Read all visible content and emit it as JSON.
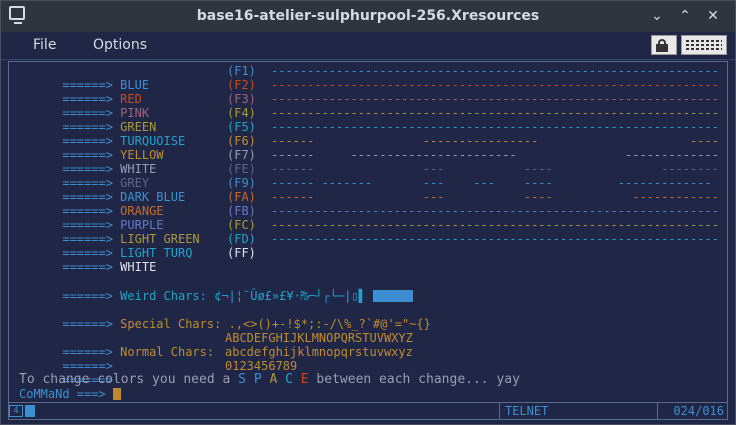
{
  "window": {
    "title": "base16-atelier-sulphurpool-256.Xresources"
  },
  "icons": {
    "app": "terminal-icon",
    "minimize": "minimize-icon",
    "maximize": "maximize-icon",
    "close": "close-icon",
    "lock": "lock-icon",
    "keyboard": "keyboard-icon"
  },
  "window_buttons": {
    "minimize": "⌄",
    "maximize": "⌃",
    "close": "✕"
  },
  "menu": {
    "file": "File",
    "options": "Options"
  },
  "colors": {
    "background": "#202746",
    "arrow": "#3d8fd1",
    "blue": "#3d8fd1",
    "red": "#c94922",
    "pink": "#9c637a",
    "green": "#ac9739",
    "turquoise": "#22a2c9",
    "yellow": "#c08b30",
    "white": "#979db4",
    "grey": "#5e6687",
    "dark_blue": "#3d8fd1",
    "orange": "#c76b29",
    "purple": "#6679cc",
    "light_green": "#ac9739",
    "light_turq": "#22a2c9",
    "bright_white": "#dfe2f1"
  },
  "color_rows": [
    {
      "arrow": "======>",
      "name": "BLUE",
      "key": "(F1)",
      "pattern": "--------------------------------------------------------------"
    },
    {
      "arrow": "======>",
      "name": "RED",
      "key": "(F2)",
      "pattern": "--------------------------------------------------------------"
    },
    {
      "arrow": "======>",
      "name": "PINK",
      "key": "(F3)",
      "pattern": "--------------------------------------------------------------"
    },
    {
      "arrow": "======>",
      "name": "GREEN",
      "key": "(F4)",
      "pattern": "--------------------------------------------------------------"
    },
    {
      "arrow": "======>",
      "name": "TURQUOISE",
      "key": "(F5)",
      "pattern": "--------------------------------------------------------------"
    },
    {
      "arrow": "======>",
      "name": "YELLOW",
      "key": "(F6)",
      "pattern": "------               ----------------                     ----"
    },
    {
      "arrow": "======>",
      "name": "WHITE",
      "key": "(F7)",
      "pattern": "------     -----------------------               -------------"
    },
    {
      "arrow": "======>",
      "name": "GREY",
      "key": "(FE)",
      "pattern": "------               ---           ----               --------"
    },
    {
      "arrow": "======>",
      "name": "DARK BLUE",
      "key": "(F9)",
      "pattern": "------ -------       ---    ---    ----         -------------"
    },
    {
      "arrow": "======>",
      "name": "ORANGE",
      "key": "(FA)",
      "pattern": "------               ---           ----           ------------"
    },
    {
      "arrow": "======>",
      "name": "PURPLE",
      "key": "(FB)",
      "pattern": "--------------------------------------------------------------"
    },
    {
      "arrow": "======>",
      "name": "LIGHT GREEN",
      "key": "(FC)",
      "pattern": "--------------------------------------------------------------"
    },
    {
      "arrow": "======>",
      "name": "LIGHT TURQ",
      "key": "(FD)",
      "pattern": "--------------------------------------------------------------"
    },
    {
      "arrow": "======>",
      "name": "WHITE",
      "key": "(FF)",
      "pattern": ""
    }
  ],
  "weird": {
    "arrow": "======>",
    "label": "Weird Chars:",
    "chars": "¢¬|¦¨Ûø£»£¥·₧⌐┘┌└─|▯▌"
  },
  "special": {
    "arrow": "======>",
    "label": "Special Chars:",
    "chars": ".,<>()+-!$*;:-/\\%_?`#@'=\"~{}"
  },
  "normal": {
    "arrow": "======>",
    "label": "Normal Chars:",
    "upper": "ABCDEFGHIJKLMNOPQRSTUVWXYZ",
    "lower": "abcdefghijklmnopqrstuvwxyz",
    "digits": "0123456789"
  },
  "hint": {
    "before": "To change colors you need a ",
    "s": "S",
    "p": "P",
    "a": "A",
    "c": "C",
    "e": "E",
    "after": " between each change... yay"
  },
  "prompt": {
    "label": "CoMMaNd ===> "
  },
  "status": {
    "icon_label": "4",
    "mode": "TELNET",
    "position": "024/016"
  }
}
